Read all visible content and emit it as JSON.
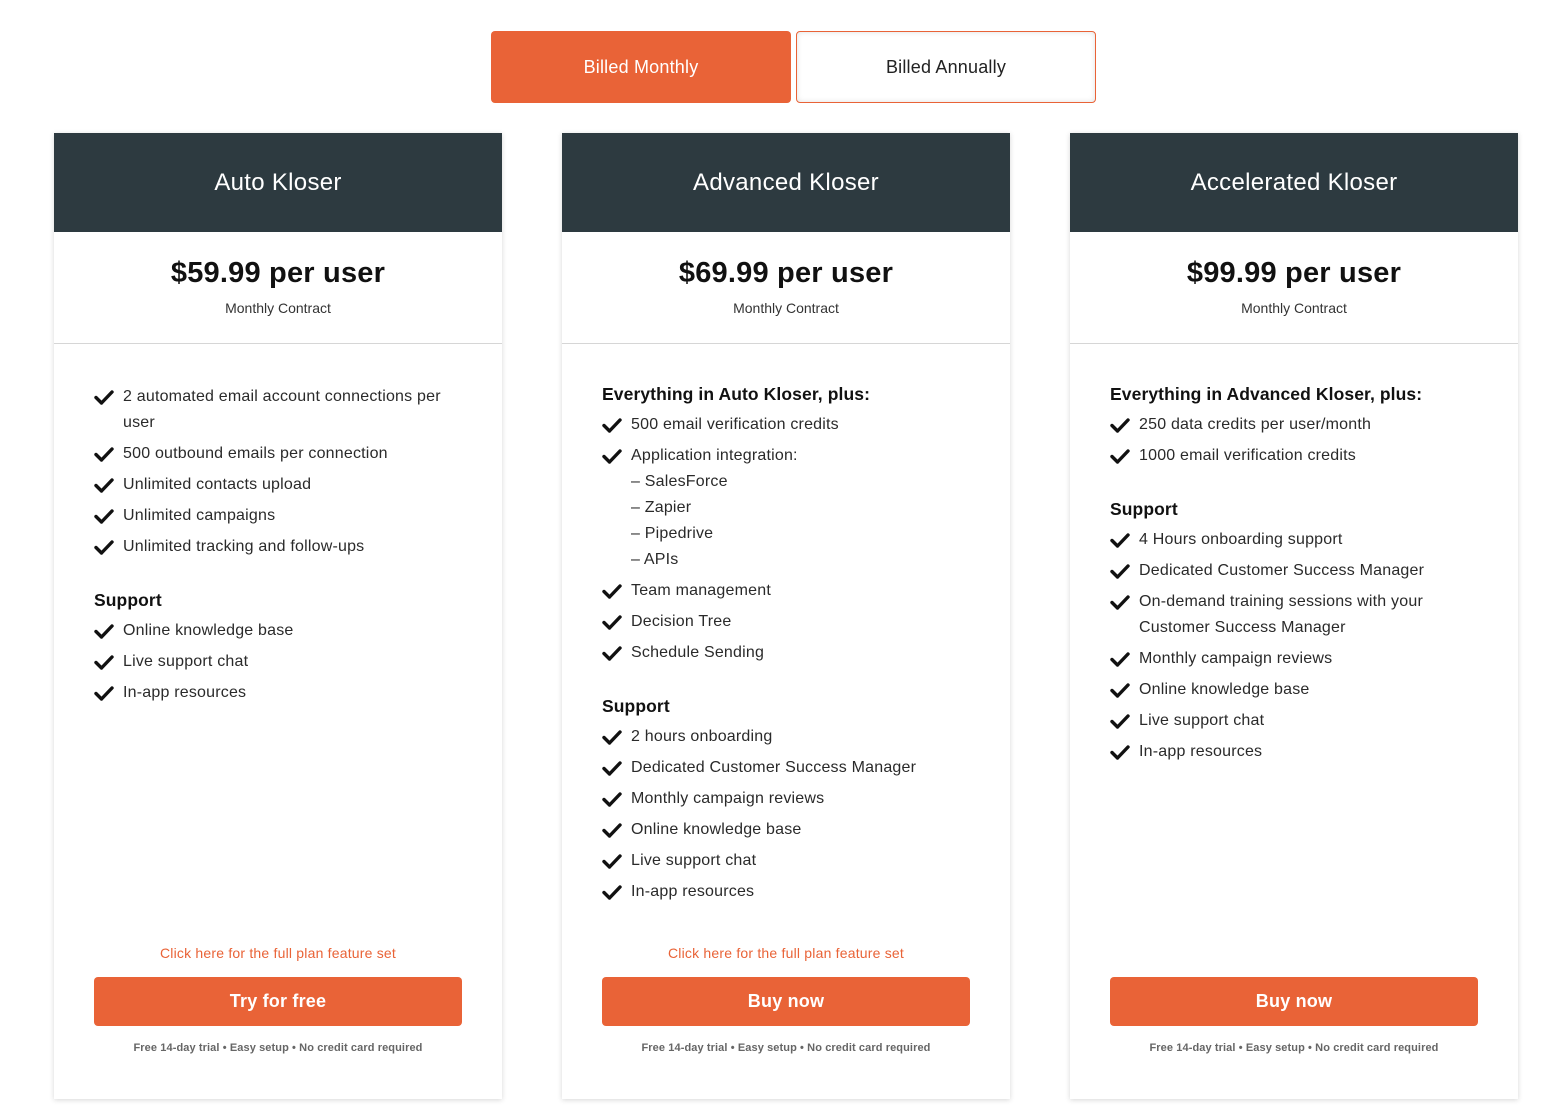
{
  "colors": {
    "accent": "#e96337",
    "header": "#2d3a40"
  },
  "billing_toggle": {
    "monthly_label": "Billed Monthly",
    "annually_label": "Billed Annually",
    "selected": "monthly"
  },
  "plans": [
    {
      "name": "Auto Kloser",
      "price": "$59.99 per user",
      "contract": "Monthly Contract",
      "intro": "",
      "features": [
        "2 automated email account connections per user",
        "500 outbound emails per connection",
        "Unlimited contacts upload",
        "Unlimited campaigns",
        "Unlimited tracking and follow-ups"
      ],
      "support_title": "Support",
      "support": [
        "Online knowledge base",
        "Live support chat",
        "In-app resources"
      ],
      "full_link": "Click here for the full plan feature set",
      "cta": "Try for free",
      "fine_print": "Free 14-day trial • Easy setup • No credit card required"
    },
    {
      "name": "Advanced Kloser",
      "price": "$69.99 per user",
      "contract": "Monthly Contract",
      "intro": "Everything in Auto Kloser, plus:",
      "features": [
        "500 email verification credits",
        "Application integration:",
        "Team management",
        "Decision Tree",
        "Schedule Sending"
      ],
      "integrations": [
        "– SalesForce",
        "– Zapier",
        "– Pipedrive",
        "– APIs"
      ],
      "support_title": "Support",
      "support": [
        "2 hours onboarding",
        "Dedicated Customer Success Manager",
        "Monthly campaign reviews",
        "Online knowledge base",
        "Live support chat",
        "In-app resources"
      ],
      "full_link": "Click here for the full plan feature set",
      "cta": "Buy now",
      "fine_print": "Free 14-day trial • Easy setup • No credit card required"
    },
    {
      "name": "Accelerated Kloser",
      "price": "$99.99 per user",
      "contract": "Monthly Contract",
      "intro": "Everything in Advanced Kloser, plus:",
      "features": [
        "250 data credits per user/month",
        "1000 email verification credits"
      ],
      "support_title": "Support",
      "support": [
        "4 Hours onboarding support",
        "Dedicated Customer Success Manager",
        "On-demand training sessions with your Customer Success Manager",
        "Monthly campaign reviews",
        "Online knowledge base",
        "Live support chat",
        "In-app resources"
      ],
      "cta": "Buy now",
      "fine_print": "Free 14-day trial • Easy setup • No credit card required"
    }
  ]
}
